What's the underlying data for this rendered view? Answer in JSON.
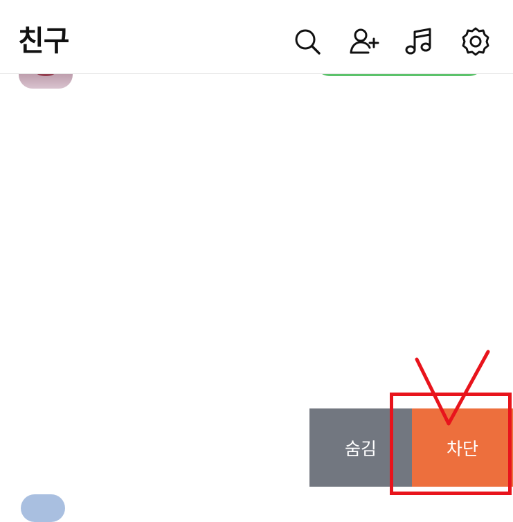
{
  "header": {
    "title": "친구",
    "icons": [
      "search-icon",
      "add-friend-icon",
      "music-icon",
      "settings-icon"
    ]
  },
  "swipe_actions": {
    "hide_label": "숨김",
    "block_label": "차단"
  },
  "colors": {
    "hide_bg": "#727780",
    "block_bg": "#ed6f3d",
    "annotation": "#e8141c",
    "pill_border": "#5cc26b"
  }
}
